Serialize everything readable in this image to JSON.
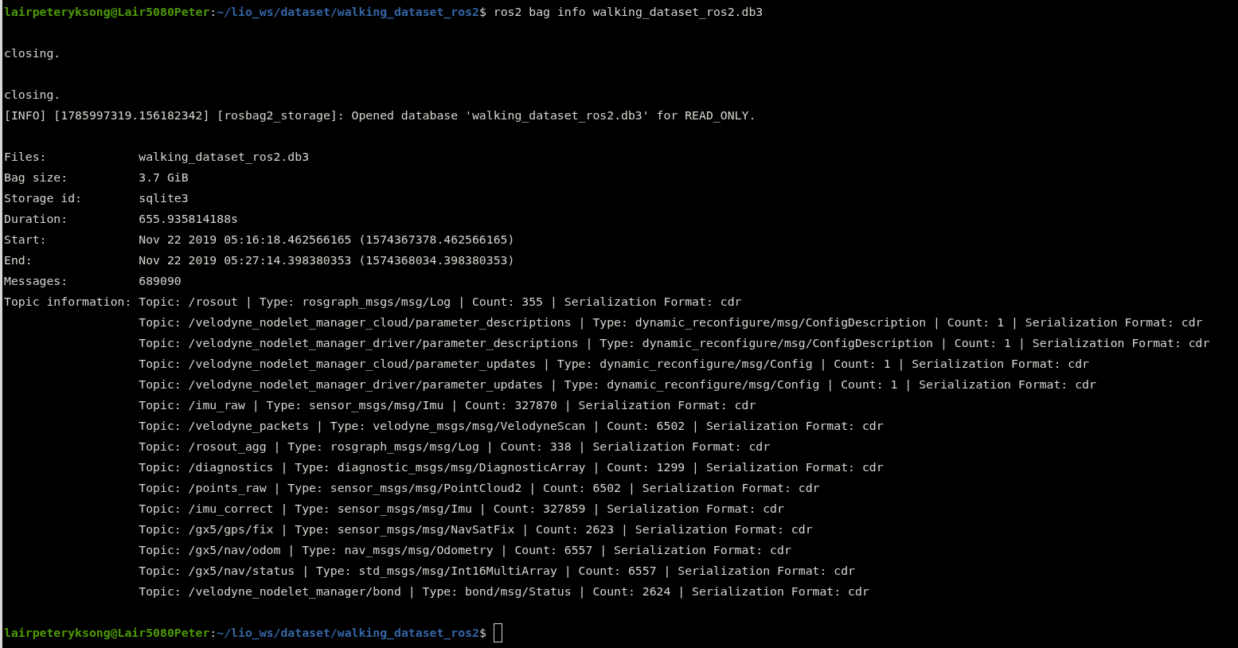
{
  "terminal": {
    "lines": [
      {
        "kind": "prompt",
        "user": "lairpeteryksong@Lair5080Peter",
        "separator": ":",
        "path": "~/lio_ws/dataset/walking_dataset_ros2",
        "symbol": "$",
        "command": "ros2 bag info walking_dataset_ros2.db3"
      },
      {
        "kind": "blank"
      },
      {
        "kind": "text",
        "text": "closing."
      },
      {
        "kind": "blank"
      },
      {
        "kind": "text",
        "text": "closing."
      },
      {
        "kind": "text",
        "text": "[INFO] [1785997319.156182342] [rosbag2_storage]: Opened database 'walking_dataset_ros2.db3' for READ_ONLY."
      },
      {
        "kind": "blank"
      },
      {
        "kind": "field",
        "label": "Files:",
        "value": "walking_dataset_ros2.db3"
      },
      {
        "kind": "field",
        "label": "Bag size:",
        "value": "3.7 GiB"
      },
      {
        "kind": "field",
        "label": "Storage id:",
        "value": "sqlite3"
      },
      {
        "kind": "field",
        "label": "Duration:",
        "value": "655.935814188s"
      },
      {
        "kind": "field",
        "label": "Start:",
        "value": "Nov 22 2019 05:16:18.462566165 (1574367378.462566165)"
      },
      {
        "kind": "field",
        "label": "End:",
        "value": "Nov 22 2019 05:27:14.398380353 (1574368034.398380353)"
      },
      {
        "kind": "field",
        "label": "Messages:",
        "value": "689090"
      },
      {
        "kind": "field",
        "label": "Topic information:",
        "value": "Topic: /rosout | Type: rosgraph_msgs/msg/Log | Count: 355 | Serialization Format: cdr"
      },
      {
        "kind": "field",
        "value": "Topic: /velodyne_nodelet_manager_cloud/parameter_descriptions | Type: dynamic_reconfigure/msg/ConfigDescription | Count: 1 | Serialization Format: cdr"
      },
      {
        "kind": "field",
        "value": "Topic: /velodyne_nodelet_manager_driver/parameter_descriptions | Type: dynamic_reconfigure/msg/ConfigDescription | Count: 1 | Serialization Format: cdr"
      },
      {
        "kind": "field",
        "value": "Topic: /velodyne_nodelet_manager_cloud/parameter_updates | Type: dynamic_reconfigure/msg/Config | Count: 1 | Serialization Format: cdr"
      },
      {
        "kind": "field",
        "value": "Topic: /velodyne_nodelet_manager_driver/parameter_updates | Type: dynamic_reconfigure/msg/Config | Count: 1 | Serialization Format: cdr"
      },
      {
        "kind": "field",
        "value": "Topic: /imu_raw | Type: sensor_msgs/msg/Imu | Count: 327870 | Serialization Format: cdr"
      },
      {
        "kind": "field",
        "value": "Topic: /velodyne_packets | Type: velodyne_msgs/msg/VelodyneScan | Count: 6502 | Serialization Format: cdr"
      },
      {
        "kind": "field",
        "value": "Topic: /rosout_agg | Type: rosgraph_msgs/msg/Log | Count: 338 | Serialization Format: cdr"
      },
      {
        "kind": "field",
        "value": "Topic: /diagnostics | Type: diagnostic_msgs/msg/DiagnosticArray | Count: 1299 | Serialization Format: cdr"
      },
      {
        "kind": "field",
        "value": "Topic: /points_raw | Type: sensor_msgs/msg/PointCloud2 | Count: 6502 | Serialization Format: cdr"
      },
      {
        "kind": "field",
        "value": "Topic: /imu_correct | Type: sensor_msgs/msg/Imu | Count: 327859 | Serialization Format: cdr"
      },
      {
        "kind": "field",
        "value": "Topic: /gx5/gps/fix | Type: sensor_msgs/msg/NavSatFix | Count: 2623 | Serialization Format: cdr"
      },
      {
        "kind": "field",
        "value": "Topic: /gx5/nav/odom | Type: nav_msgs/msg/Odometry | Count: 6557 | Serialization Format: cdr"
      },
      {
        "kind": "field",
        "value": "Topic: /gx5/nav/status | Type: std_msgs/msg/Int16MultiArray | Count: 6557 | Serialization Format: cdr"
      },
      {
        "kind": "field",
        "value": "Topic: /velodyne_nodelet_manager/bond | Type: bond/msg/Status | Count: 2624 | Serialization Format: cdr"
      },
      {
        "kind": "blank"
      },
      {
        "kind": "prompt",
        "user": "lairpeteryksong@Lair5080Peter",
        "separator": ":",
        "path": "~/lio_ws/dataset/walking_dataset_ros2",
        "symbol": "$",
        "cursor": true
      }
    ]
  }
}
